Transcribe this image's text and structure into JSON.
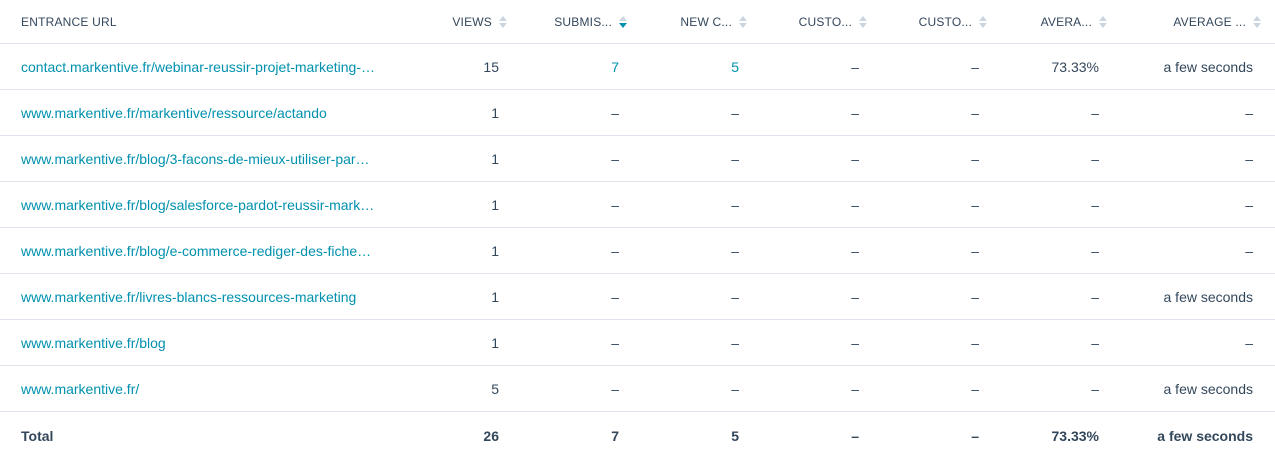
{
  "table": {
    "headers": [
      {
        "key": "url",
        "label": "ENTRANCE URL",
        "sortable": false
      },
      {
        "key": "views",
        "label": "VIEWS",
        "sortable": true,
        "active": false
      },
      {
        "key": "submissions",
        "label": "SUBMIS...",
        "sortable": true,
        "active": true
      },
      {
        "key": "new_contacts",
        "label": "NEW C...",
        "sortable": true,
        "active": false
      },
      {
        "key": "custom1",
        "label": "CUSTO...",
        "sortable": true,
        "active": false
      },
      {
        "key": "custom2",
        "label": "CUSTO...",
        "sortable": true,
        "active": false
      },
      {
        "key": "avg1",
        "label": "AVERA...",
        "sortable": true,
        "active": false
      },
      {
        "key": "avg2",
        "label": "AVERAGE ...",
        "sortable": true,
        "active": false
      }
    ],
    "rows": [
      {
        "url": "contact.markentive.fr/webinar-reussir-projet-marketing-…",
        "views": "15",
        "submissions": "7",
        "new_contacts": "5",
        "custom1": "–",
        "custom2": "–",
        "avg1": "73.33%",
        "avg2": "a few seconds",
        "links": [
          "submissions",
          "new_contacts"
        ]
      },
      {
        "url": "www.markentive.fr/markentive/ressource/actando",
        "views": "1",
        "submissions": "–",
        "new_contacts": "–",
        "custom1": "–",
        "custom2": "–",
        "avg1": "–",
        "avg2": "–",
        "links": []
      },
      {
        "url": "www.markentive.fr/blog/3-facons-de-mieux-utiliser-par…",
        "views": "1",
        "submissions": "–",
        "new_contacts": "–",
        "custom1": "–",
        "custom2": "–",
        "avg1": "–",
        "avg2": "–",
        "links": []
      },
      {
        "url": "www.markentive.fr/blog/salesforce-pardot-reussir-mark…",
        "views": "1",
        "submissions": "–",
        "new_contacts": "–",
        "custom1": "–",
        "custom2": "–",
        "avg1": "–",
        "avg2": "–",
        "links": []
      },
      {
        "url": "www.markentive.fr/blog/e-commerce-rediger-des-fiche…",
        "views": "1",
        "submissions": "–",
        "new_contacts": "–",
        "custom1": "–",
        "custom2": "–",
        "avg1": "–",
        "avg2": "–",
        "links": []
      },
      {
        "url": "www.markentive.fr/livres-blancs-ressources-marketing",
        "views": "1",
        "submissions": "–",
        "new_contacts": "–",
        "custom1": "–",
        "custom2": "–",
        "avg1": "–",
        "avg2": "a few seconds",
        "links": []
      },
      {
        "url": "www.markentive.fr/blog",
        "views": "1",
        "submissions": "–",
        "new_contacts": "–",
        "custom1": "–",
        "custom2": "–",
        "avg1": "–",
        "avg2": "–",
        "links": []
      },
      {
        "url": "www.markentive.fr/",
        "views": "5",
        "submissions": "–",
        "new_contacts": "–",
        "custom1": "–",
        "custom2": "–",
        "avg1": "–",
        "avg2": "a few seconds",
        "links": []
      }
    ],
    "total": {
      "url": "Total",
      "views": "26",
      "submissions": "7",
      "new_contacts": "5",
      "custom1": "–",
      "custom2": "–",
      "avg1": "73.33%",
      "avg2": "a few seconds"
    }
  },
  "colors": {
    "link": "#0091ae",
    "text": "#33475b",
    "border": "#dfe3eb",
    "sort_inactive": "#cbd6e2",
    "sort_active": "#0091ae"
  }
}
